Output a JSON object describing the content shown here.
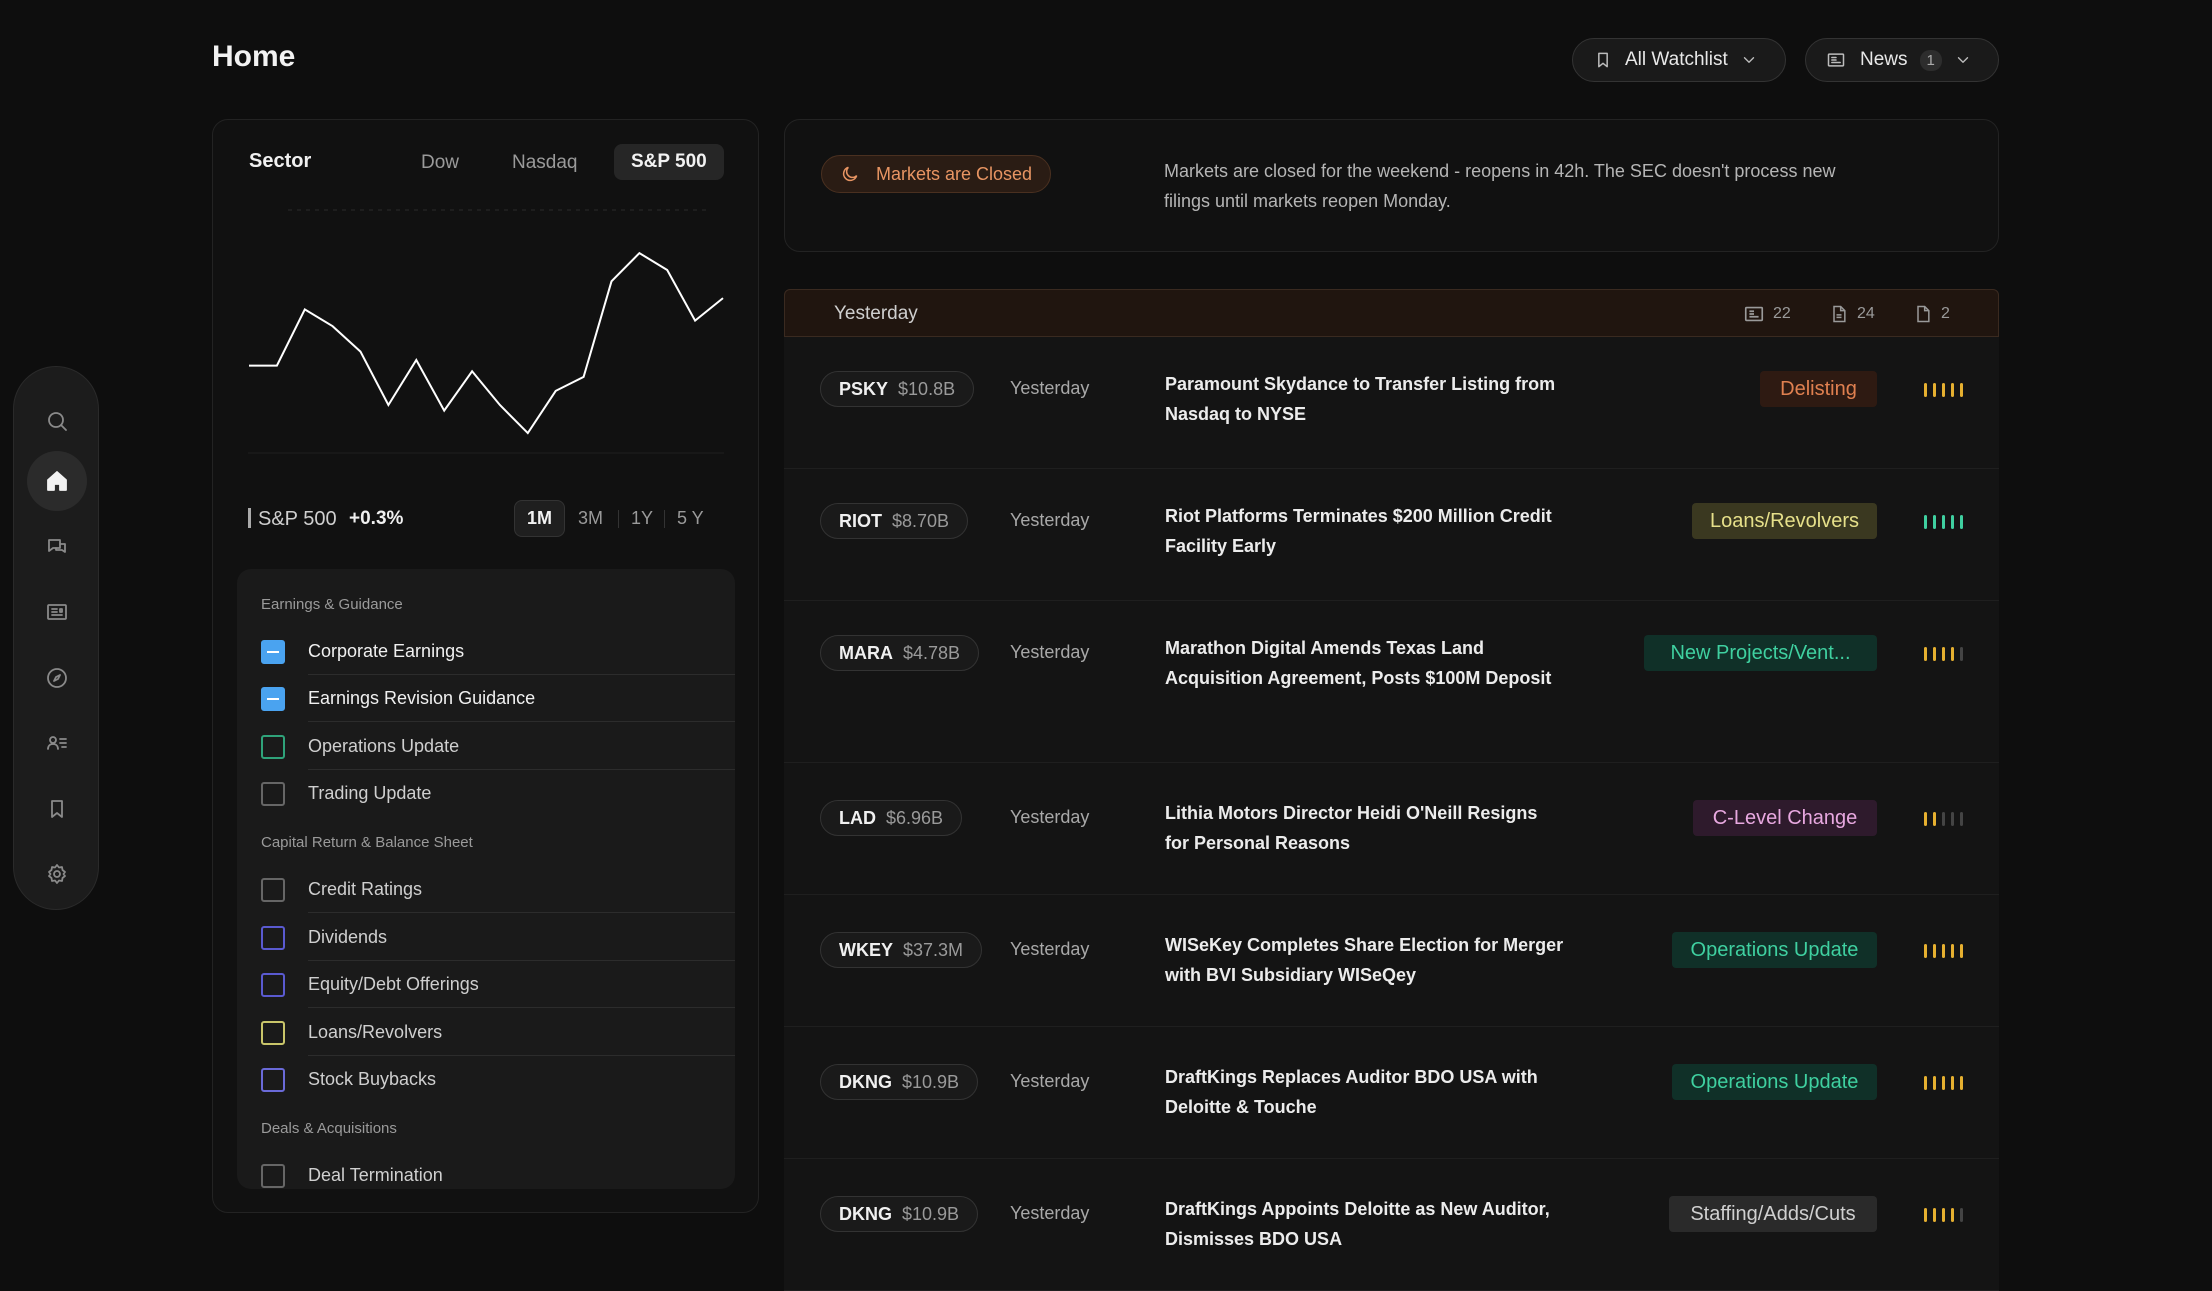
{
  "header": {
    "title": "Home",
    "watchlist_label": "All Watchlist",
    "news_label": "News",
    "news_count": "1"
  },
  "sector": {
    "title": "Sector",
    "tabs": [
      "Dow",
      "Nasdaq",
      "S&P 500"
    ],
    "active_tab": "S&P 500",
    "index_label": "S&P 500",
    "change": "+0.3%",
    "ranges": [
      "1M",
      "3M",
      "1Y",
      "5 Y"
    ],
    "active_range": "1M"
  },
  "chart_data": {
    "type": "line",
    "title": "",
    "series": [
      {
        "values": [
          30,
          30,
          50,
          44,
          35,
          16,
          32,
          14,
          28,
          16,
          6,
          21,
          26,
          60,
          70,
          64,
          46,
          54
        ]
      }
    ],
    "ylim": [
      0,
      80
    ],
    "grid": false,
    "color": "#ffffff"
  },
  "filters": {
    "groups": [
      {
        "name": "Earnings & Guidance",
        "items": [
          {
            "label": "Corporate Earnings",
            "checked": true,
            "color": "#4aa3f0"
          },
          {
            "label": "Earnings Revision Guidance",
            "checked": true,
            "color": "#4aa3f0"
          },
          {
            "label": "Operations Update",
            "checked": false,
            "color": "#2fa37a"
          },
          {
            "label": "Trading Update",
            "checked": false,
            "color": "#777777"
          }
        ]
      },
      {
        "name": "Capital Return & Balance Sheet",
        "items": [
          {
            "label": "Credit Ratings",
            "checked": false,
            "color": "#777777"
          },
          {
            "label": "Dividends",
            "checked": false,
            "color": "#5a5ad0"
          },
          {
            "label": "Equity/Debt Offerings",
            "checked": false,
            "color": "#5a5ad0"
          },
          {
            "label": "Loans/Revolvers",
            "checked": false,
            "color": "#c9c56a"
          },
          {
            "label": "Stock Buybacks",
            "checked": false,
            "color": "#6a6ad8"
          }
        ]
      },
      {
        "name": "Deals & Acquisitions",
        "items": [
          {
            "label": "Deal Termination",
            "checked": false,
            "color": "#777777"
          }
        ]
      }
    ]
  },
  "market": {
    "status": "Markets are Closed",
    "notice": "Markets are closed for the weekend - reopens in 42h. The SEC doesn't process new filings until markets reopen Monday."
  },
  "feed": {
    "group_label": "Yesterday",
    "counts": {
      "news": "22",
      "filings": "24",
      "presentations": "2"
    },
    "rows": [
      {
        "ticker": "PSKY",
        "mcap": "$10.8B",
        "when": "Yesterday",
        "headline": "Paramount Skydance to Transfer Listing from Nasdaq to NYSE",
        "tag": "Delisting",
        "tag_fg": "#e08050",
        "tag_bg": "#2e1a12",
        "strength": 5,
        "bar_color": "#e6b030"
      },
      {
        "ticker": "RIOT",
        "mcap": "$8.70B",
        "when": "Yesterday",
        "headline": "Riot Platforms Terminates $200 Million Credit Facility Early",
        "tag": "Loans/Revolvers",
        "tag_fg": "#e6e08a",
        "tag_bg": "#3a3820",
        "strength": 5,
        "bar_color": "#3fd0a0"
      },
      {
        "ticker": "MARA",
        "mcap": "$4.78B",
        "when": "Yesterday",
        "headline": "Marathon Digital Amends Texas Land Acquisition Agreement, Posts $100M Deposit",
        "tag": "New Projects/Vent...",
        "tag_fg": "#3fd0a0",
        "tag_bg": "#103028",
        "strength": 4,
        "bar_color": "#e6b030"
      },
      {
        "ticker": "LAD",
        "mcap": "$6.96B",
        "when": "Yesterday",
        "headline": "Lithia Motors Director Heidi O'Neill Resigns for Personal Reasons",
        "tag": "C-Level Change",
        "tag_fg": "#e8a8e0",
        "tag_bg": "#2e1a2c",
        "strength": 2,
        "bar_color": "#e6b030"
      },
      {
        "ticker": "WKEY",
        "mcap": "$37.3M",
        "when": "Yesterday",
        "headline": "WISeKey Completes Share Election for Merger with BVI Subsidiary WISeQey",
        "tag": "Operations Update",
        "tag_fg": "#3fd0a0",
        "tag_bg": "#103028",
        "strength": 5,
        "bar_color": "#e6b030"
      },
      {
        "ticker": "DKNG",
        "mcap": "$10.9B",
        "when": "Yesterday",
        "headline": "DraftKings Replaces Auditor BDO USA with Deloitte & Touche",
        "tag": "Operations Update",
        "tag_fg": "#3fd0a0",
        "tag_bg": "#103028",
        "strength": 5,
        "bar_color": "#e6b030"
      },
      {
        "ticker": "DKNG",
        "mcap": "$10.9B",
        "when": "Yesterday",
        "headline": "DraftKings Appoints Deloitte as New Auditor, Dismisses BDO USA",
        "tag": "Staffing/Adds/Cuts",
        "tag_fg": "#d0d0d0",
        "tag_bg": "#2a2a2a",
        "strength": 4,
        "bar_color": "#e6b030"
      }
    ]
  }
}
